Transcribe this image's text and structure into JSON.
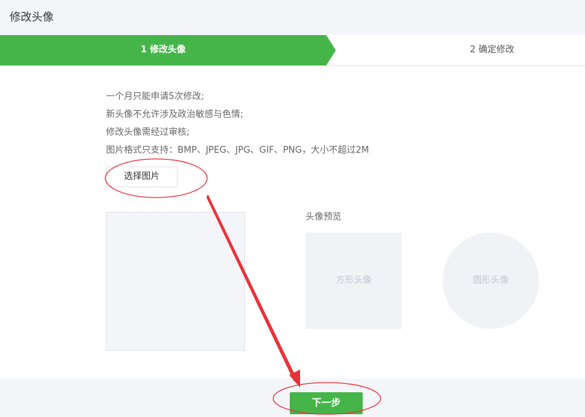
{
  "header": {
    "title": "修改头像"
  },
  "steps": [
    {
      "label": "1 修改头像",
      "active": true
    },
    {
      "label": "2 确定修改",
      "active": false
    }
  ],
  "rules": [
    "一个月只能申请5次修改;",
    "新头像不允许涉及政治敏感与色情;",
    "修改头像需经过审核;",
    "图片格式只支持：BMP、JPEG、JPG、GIF、PNG，大小不超过2M"
  ],
  "upload": {
    "choose_label": "选择图片"
  },
  "preview": {
    "title": "头像预览",
    "square_label": "方形头像",
    "circle_label": "圆形头像"
  },
  "footer": {
    "next_label": "下一步"
  },
  "colors": {
    "accent": "#45b549",
    "annotation": "#e8323a",
    "panel_bg": "#f4f5f9"
  }
}
